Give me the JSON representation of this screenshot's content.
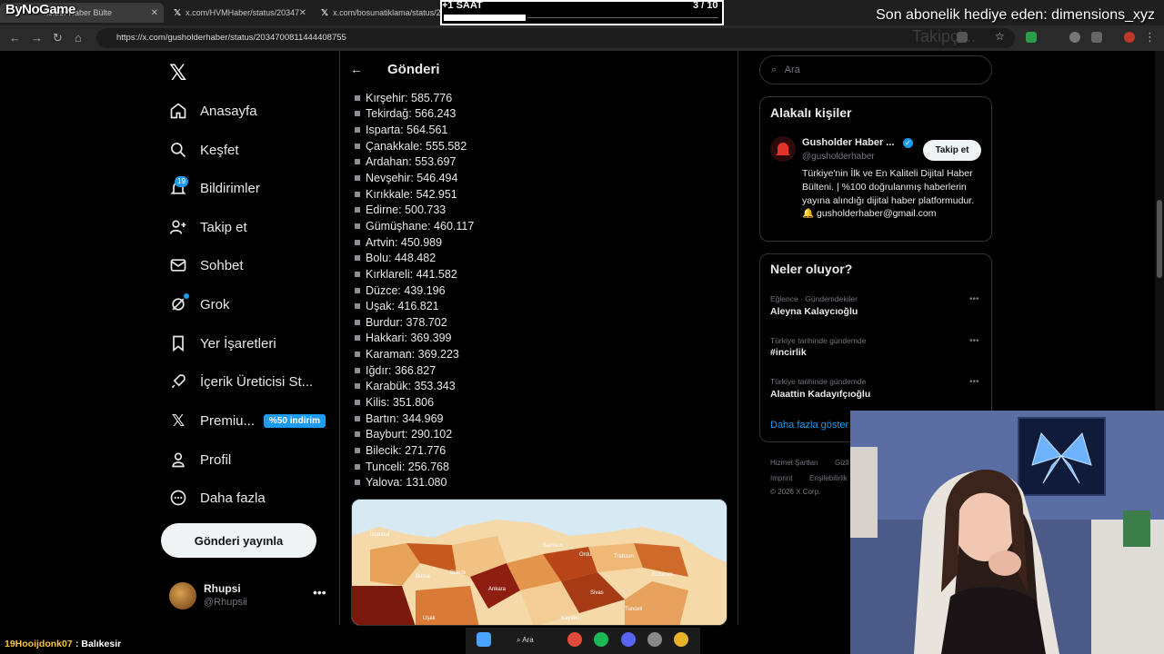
{
  "overlay": {
    "brand": "ByNoGame",
    "timer_label": "+1 SAAT",
    "timer_count": "3 / 10",
    "sub_notice": "Son abonelik hediye eden: dimensions_xyz",
    "watermark": "Takipçi..."
  },
  "browser": {
    "tabs": [
      {
        "label": "holder Haber Bülte"
      },
      {
        "label": "x.com/HVMHaber/status/20347"
      },
      {
        "label": "x.com/bosunatiklama/status/20..."
      }
    ],
    "url": "https://x.com/gusholderhaber/status/2034700811444408755"
  },
  "sidebar": {
    "items": [
      {
        "label": "Anasayfa",
        "icon": "home-icon"
      },
      {
        "label": "Keşfet",
        "icon": "search-icon"
      },
      {
        "label": "Bildirimler",
        "icon": "bell-icon"
      },
      {
        "label": "Takip et",
        "icon": "follow-icon"
      },
      {
        "label": "Sohbet",
        "icon": "mail-icon"
      },
      {
        "label": "Grok",
        "icon": "grok-icon"
      },
      {
        "label": "Yer İşaretleri",
        "icon": "bookmark-icon"
      },
      {
        "label": "İçerik Üreticisi St...",
        "icon": "rocket-icon"
      },
      {
        "label": "Premiu...",
        "icon": "x-icon"
      },
      {
        "label": "Profil",
        "icon": "person-icon"
      },
      {
        "label": "Daha fazla",
        "icon": "more-icon"
      }
    ],
    "notif_count": "19",
    "premium_badge": "%50 indirim",
    "post_button": "Gönderi yayınla",
    "account": {
      "name": "Rhupsi",
      "handle": "@Rhupsii"
    }
  },
  "main": {
    "title": "Gönderi",
    "cities": [
      "Kırşehir: 585.776",
      "Tekirdağ: 566.243",
      "Isparta: 564.561",
      "Çanakkale: 555.582",
      "Ardahan: 553.697",
      "Nevşehir: 546.494",
      "Kırıkkale: 542.951",
      "Edirne: 500.733",
      "Gümüşhane: 460.117",
      "Artvin: 450.989",
      "Bolu: 448.482",
      "Kırklareli: 441.582",
      "Düzce: 439.196",
      "Uşak: 416.821",
      "Burdur: 378.702",
      "Hakkari: 369.399",
      "Karaman: 369.223",
      "Iğdır: 366.827",
      "Karabük: 353.343",
      "Kilis: 351.806",
      "Bartın: 344.969",
      "Bayburt: 290.102",
      "Bilecik: 271.776",
      "Tunceli: 256.768",
      "Yalova: 131.080"
    ],
    "map_labels": [
      "İstanbul",
      "Bursa",
      "Bilecik",
      "Ankara",
      "Samsun",
      "Ordu",
      "Trabzon",
      "Sivas",
      "Erzurum",
      "Tunceli",
      "Kayseri",
      "Uşak"
    ]
  },
  "right": {
    "search_placeholder": "Ara",
    "related_title": "Alakalı kişiler",
    "related_name": "Gusholder Haber ...",
    "related_handle": "@gusholderhaber",
    "follow_label": "Takip et",
    "related_bio": "Türkiye'nin İlk ve En Kaliteli Dijital Haber Bülteni. | %100 doğrulanmış haberlerin yayına alındığı dijital haber platformudur. 🔔 gusholderhaber@gmail.com",
    "trends_title": "Neler oluyor?",
    "trends": [
      {
        "context": "Eğlence · Gündemdekiler",
        "name": "Aleyna Kalaycıoğlu"
      },
      {
        "context": "Türkiye tarihinde gündemde",
        "name": "#incirlik"
      },
      {
        "context": "Türkiye tarihinde gündemde",
        "name": "Alaattin Kadayıfçıoğlu"
      }
    ],
    "show_more": "Daha fazla göster",
    "footer": [
      "Hizmet Şartları",
      "Gizli",
      "Imprint",
      "Erişilebilirlik",
      "© 2026 X Corp."
    ]
  },
  "chat": {
    "user": "19Hooijdonk07",
    "message": ": Balıkesir"
  },
  "taskbar": {
    "search_label": "Ara"
  },
  "colors": {
    "accent": "#1d9bf0",
    "bg": "#000000",
    "text": "#e7e9ea",
    "muted": "#71767b"
  }
}
